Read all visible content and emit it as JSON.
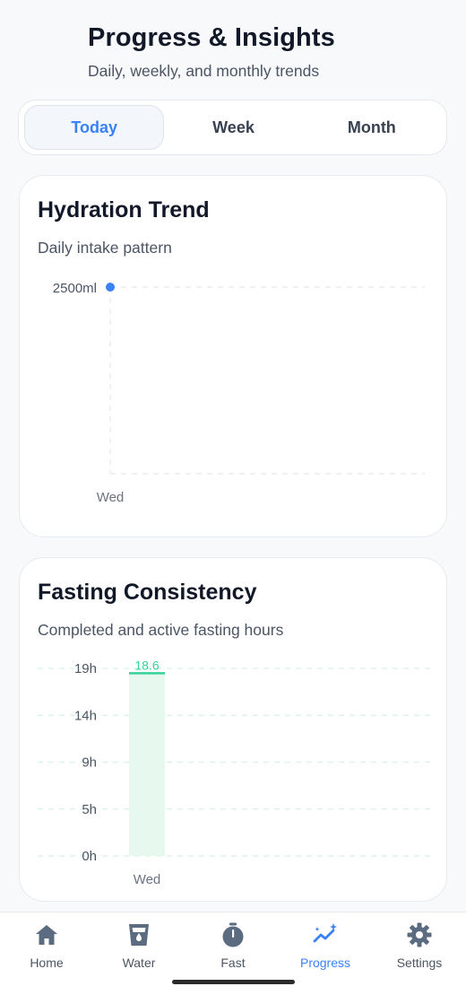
{
  "header": {
    "title": "Progress & Insights",
    "subtitle": "Daily, weekly, and monthly trends"
  },
  "tabs": [
    {
      "label": "Today",
      "active": true
    },
    {
      "label": "Week",
      "active": false
    },
    {
      "label": "Month",
      "active": false
    }
  ],
  "hydration": {
    "title": "Hydration Trend",
    "subtitle": "Daily intake pattern"
  },
  "fasting": {
    "title": "Fasting Consistency",
    "subtitle": "Completed and active fasting hours"
  },
  "chart_data": [
    {
      "type": "scatter",
      "categories": [
        "Wed"
      ],
      "y_tick_labels": [
        "2500ml"
      ],
      "series": [
        {
          "values": [
            2500
          ]
        }
      ],
      "color": "#3b82f6",
      "grid": true
    },
    {
      "type": "bar",
      "categories": [
        "Wed"
      ],
      "y_tick_labels": [
        "19h",
        "14h",
        "9h",
        "5h",
        "0h"
      ],
      "ylim": [
        0,
        19
      ],
      "series": [
        {
          "values": [
            18.6
          ]
        }
      ],
      "data_labels": [
        "18.6"
      ],
      "color": "#34d399",
      "grid": true
    }
  ],
  "nav": [
    {
      "label": "Home",
      "icon": "home-icon",
      "active": false
    },
    {
      "label": "Water",
      "icon": "water-glass-icon",
      "active": false
    },
    {
      "label": "Fast",
      "icon": "stopwatch-icon",
      "active": false
    },
    {
      "label": "Progress",
      "icon": "trend-sparkle-icon",
      "active": true
    },
    {
      "label": "Settings",
      "icon": "gear-icon",
      "active": false
    }
  ],
  "colors": {
    "accent": "#3b82f6",
    "fasting": "#34d399",
    "background": "#f7f9fb"
  }
}
